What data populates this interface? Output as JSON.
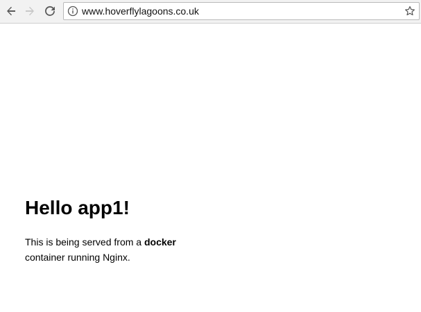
{
  "browser": {
    "url": "www.hoverflylagoons.co.uk",
    "icons": {
      "back": "back-arrow-icon",
      "forward": "forward-arrow-icon",
      "reload": "reload-icon",
      "info": "info-icon",
      "bookmark": "star-icon"
    }
  },
  "page": {
    "heading": "Hello app1!",
    "paragraph_before": "This is being served from a ",
    "paragraph_bold": "docker",
    "paragraph_after": " container running Nginx."
  },
  "colors": {
    "toolbar_bg": "#f2f2f2",
    "page_bg": "#ffffff",
    "text": "#000000"
  }
}
